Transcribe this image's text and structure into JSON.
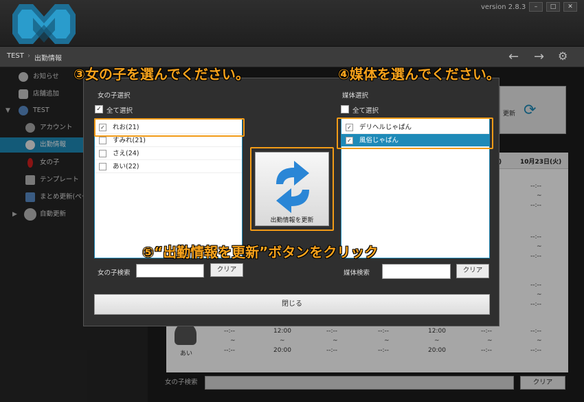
{
  "version": "version 2.8.3",
  "window_buttons": [
    "–",
    "□",
    "✕"
  ],
  "breadcrumb": {
    "root": "TEST",
    "current": "出勤情報"
  },
  "sidebar": {
    "items": [
      {
        "label": "お知らせ",
        "icon": "info-icon"
      },
      {
        "label": "店舗追加",
        "icon": "shop-add-icon"
      },
      {
        "label": "TEST",
        "icon": "home-icon"
      },
      {
        "label": "アカウント",
        "icon": "key-icon"
      },
      {
        "label": "出勤情報",
        "icon": "clock-icon",
        "selected": true
      },
      {
        "label": "女の子",
        "icon": "person-icon"
      },
      {
        "label": "テンプレート",
        "icon": "document-icon"
      },
      {
        "label": "まとめ更新(ペー",
        "icon": "upload-icon"
      },
      {
        "label": "自動更新",
        "icon": "gear-icon"
      }
    ]
  },
  "background": {
    "update_label": "更新",
    "date_headers": [
      "月)",
      "10月23日(火)"
    ],
    "cell_dash": "--:--",
    "cell_tilde": "~",
    "row_times": [
      "--:--",
      "12:00",
      "--:--",
      "--:--",
      "12:00",
      "--:--",
      "--:--"
    ],
    "row_times_end": [
      "--:--",
      "20:00",
      "--:--",
      "--:--",
      "20:00",
      "--:--",
      "--:--"
    ],
    "row_name": "あい",
    "search_label": "女の子検索",
    "clear_label": "クリア"
  },
  "dialog": {
    "girl_title": "女の子選択",
    "girl_all": "全て選択",
    "girls": [
      {
        "name": "れお(21)",
        "checked": true
      },
      {
        "name": "すみれ(21)",
        "checked": false
      },
      {
        "name": "さえ(24)",
        "checked": false
      },
      {
        "name": "あい(22)",
        "checked": false
      }
    ],
    "media_title": "媒体選択",
    "media_all": "全て選択",
    "media": [
      {
        "name": "デリヘルじゃぱん",
        "checked": true
      },
      {
        "name": "風俗じゃぱん",
        "checked": true,
        "selected": true
      }
    ],
    "girl_search_label": "女の子検索",
    "media_search_label": "媒体検索",
    "clear_label": "クリア",
    "update_button": "出勤情報を更新",
    "close_button": "閉じる"
  },
  "annotations": {
    "step3": "③女の子を選んでください。",
    "step4": "④媒体を選んでください。",
    "step5": "⑤“出勤情報を更新”ボタンをクリック"
  },
  "colors": {
    "accent": "#1e8ab8",
    "highlight": "#f29b17"
  }
}
